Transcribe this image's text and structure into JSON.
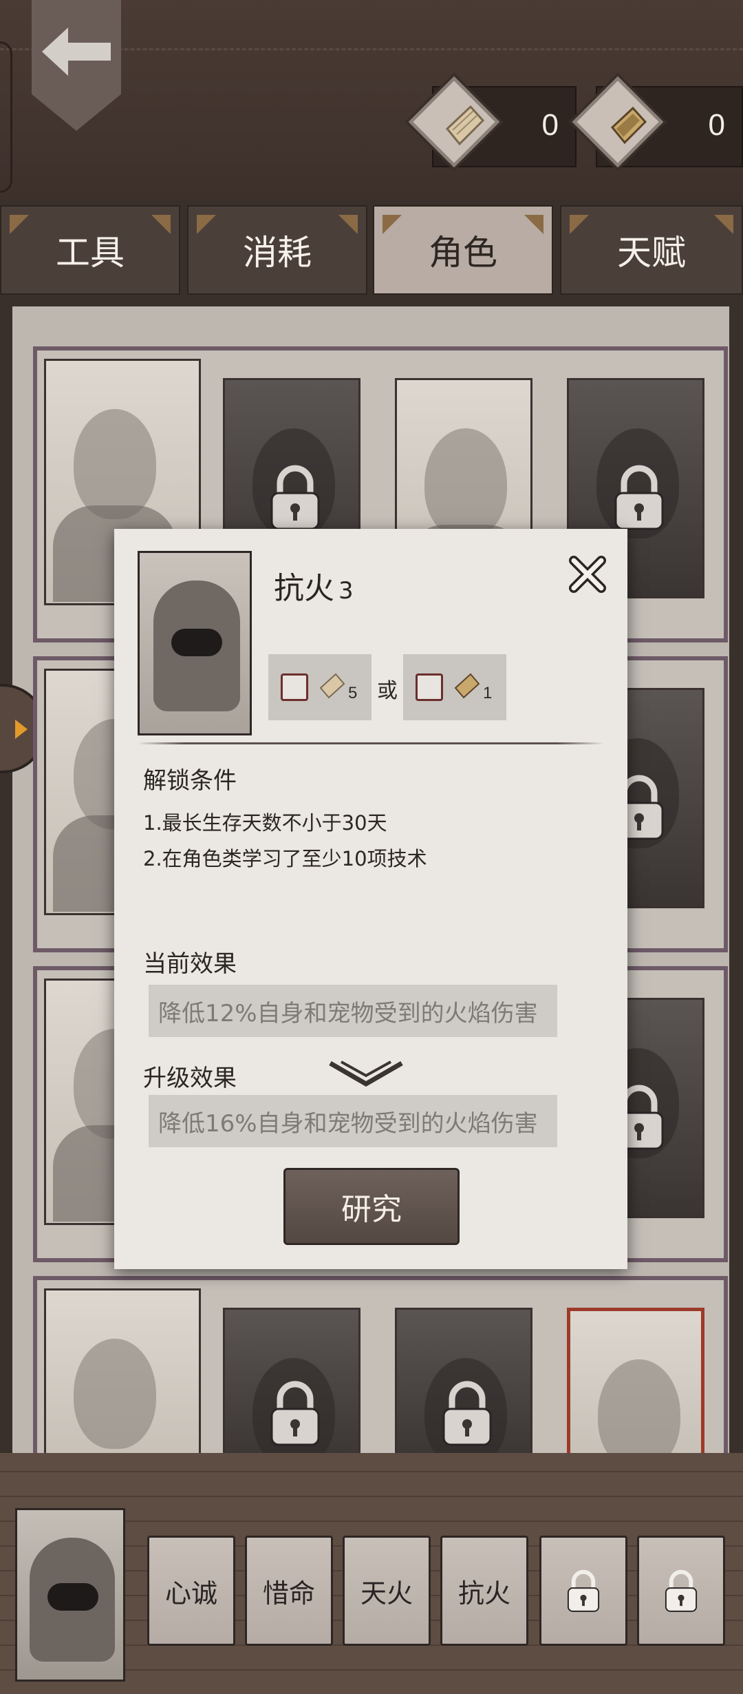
{
  "header": {
    "currencies": [
      {
        "icon": "wood-plank-icon",
        "count": "0"
      },
      {
        "icon": "book-scroll-icon",
        "count": "0"
      }
    ]
  },
  "tabs": [
    {
      "label": "工具",
      "active": false
    },
    {
      "label": "消耗",
      "active": false
    },
    {
      "label": "角色",
      "active": true
    },
    {
      "label": "天赋",
      "active": false
    }
  ],
  "dialog": {
    "title": "抗火",
    "level": "3",
    "costs": [
      {
        "icon": "wood-plank-icon",
        "amount": "5"
      },
      {
        "icon": "book-scroll-icon",
        "amount": "1"
      }
    ],
    "or_text": "或",
    "unlock_label": "解锁条件",
    "conditions": [
      "1.最长生存天数不小于30天",
      "2.在角色类学习了至少10项技术"
    ],
    "current_effect_label": "当前效果",
    "current_effect": "降低12%自身和宠物受到的火焰伤害",
    "upgrade_effect_label": "升级效果",
    "upgrade_effect": "降低16%自身和宠物受到的火焰伤害",
    "research_label": "研究"
  },
  "skills": [
    {
      "label": "心诚",
      "locked": false
    },
    {
      "label": "惜命",
      "locked": false
    },
    {
      "label": "天火",
      "locked": false
    },
    {
      "label": "抗火",
      "locked": false
    },
    {
      "label": "",
      "locked": true
    },
    {
      "label": "",
      "locked": true
    }
  ],
  "colors": {
    "accent_selected": "#9c3a2a",
    "tab_active": "#b8aca4",
    "tab_inactive": "#4b3f3a",
    "panel": "#ebe8e3"
  }
}
